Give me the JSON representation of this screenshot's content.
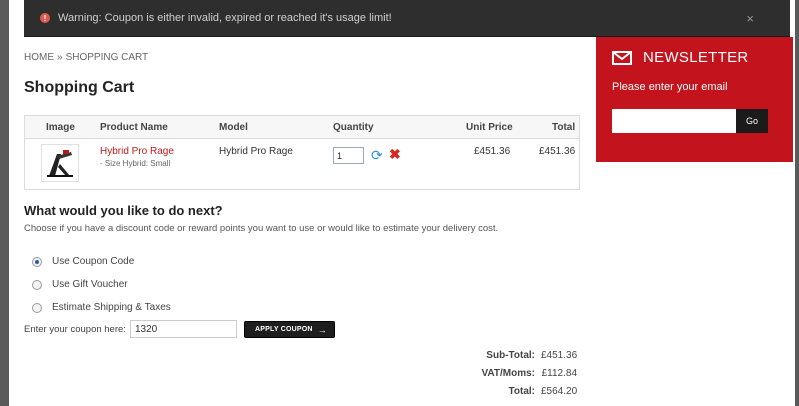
{
  "alert": {
    "text": "Warning: Coupon is either invalid, expired or reached it's usage limit!",
    "close": "×"
  },
  "breadcrumb": {
    "home": "Home",
    "separator": "»",
    "current": "Shopping Cart"
  },
  "page_title": "Shopping Cart",
  "cart": {
    "headers": {
      "image": "Image",
      "name": "Product Name",
      "model": "Model",
      "quantity": "Quantity",
      "unit_price": "Unit Price",
      "total": "Total"
    },
    "item": {
      "name": "Hybrid Pro Rage",
      "option": "- Size Hybrid: Small",
      "model": "Hybrid Pro Rage",
      "quantity": "1",
      "unit_price": "£451.36",
      "total": "£451.36"
    }
  },
  "next": {
    "title": "What would you like to do next?",
    "description": "Choose if you have a discount code or reward points you want to use or would like to estimate your delivery cost.",
    "options": [
      "Use Coupon Code",
      "Use Gift Voucher",
      "Estimate Shipping & Taxes"
    ],
    "selected": "Use Coupon Code"
  },
  "coupon": {
    "label": "Enter your coupon here:",
    "value": "1320",
    "button": "Apply Coupon",
    "button_arrow": "→"
  },
  "totals": [
    {
      "label": "Sub-Total:",
      "value": "£451.36"
    },
    {
      "label": "VAT/Moms:",
      "value": "£112.84"
    },
    {
      "label": "Total:",
      "value": "£564.20"
    }
  ],
  "newsletter": {
    "title": "NEWSLETTER",
    "subtitle": "Please enter your email",
    "button": "Go"
  },
  "colors": {
    "accent": "#c3141d",
    "link": "#c11a1a",
    "overlay": "#5a5a5a"
  }
}
